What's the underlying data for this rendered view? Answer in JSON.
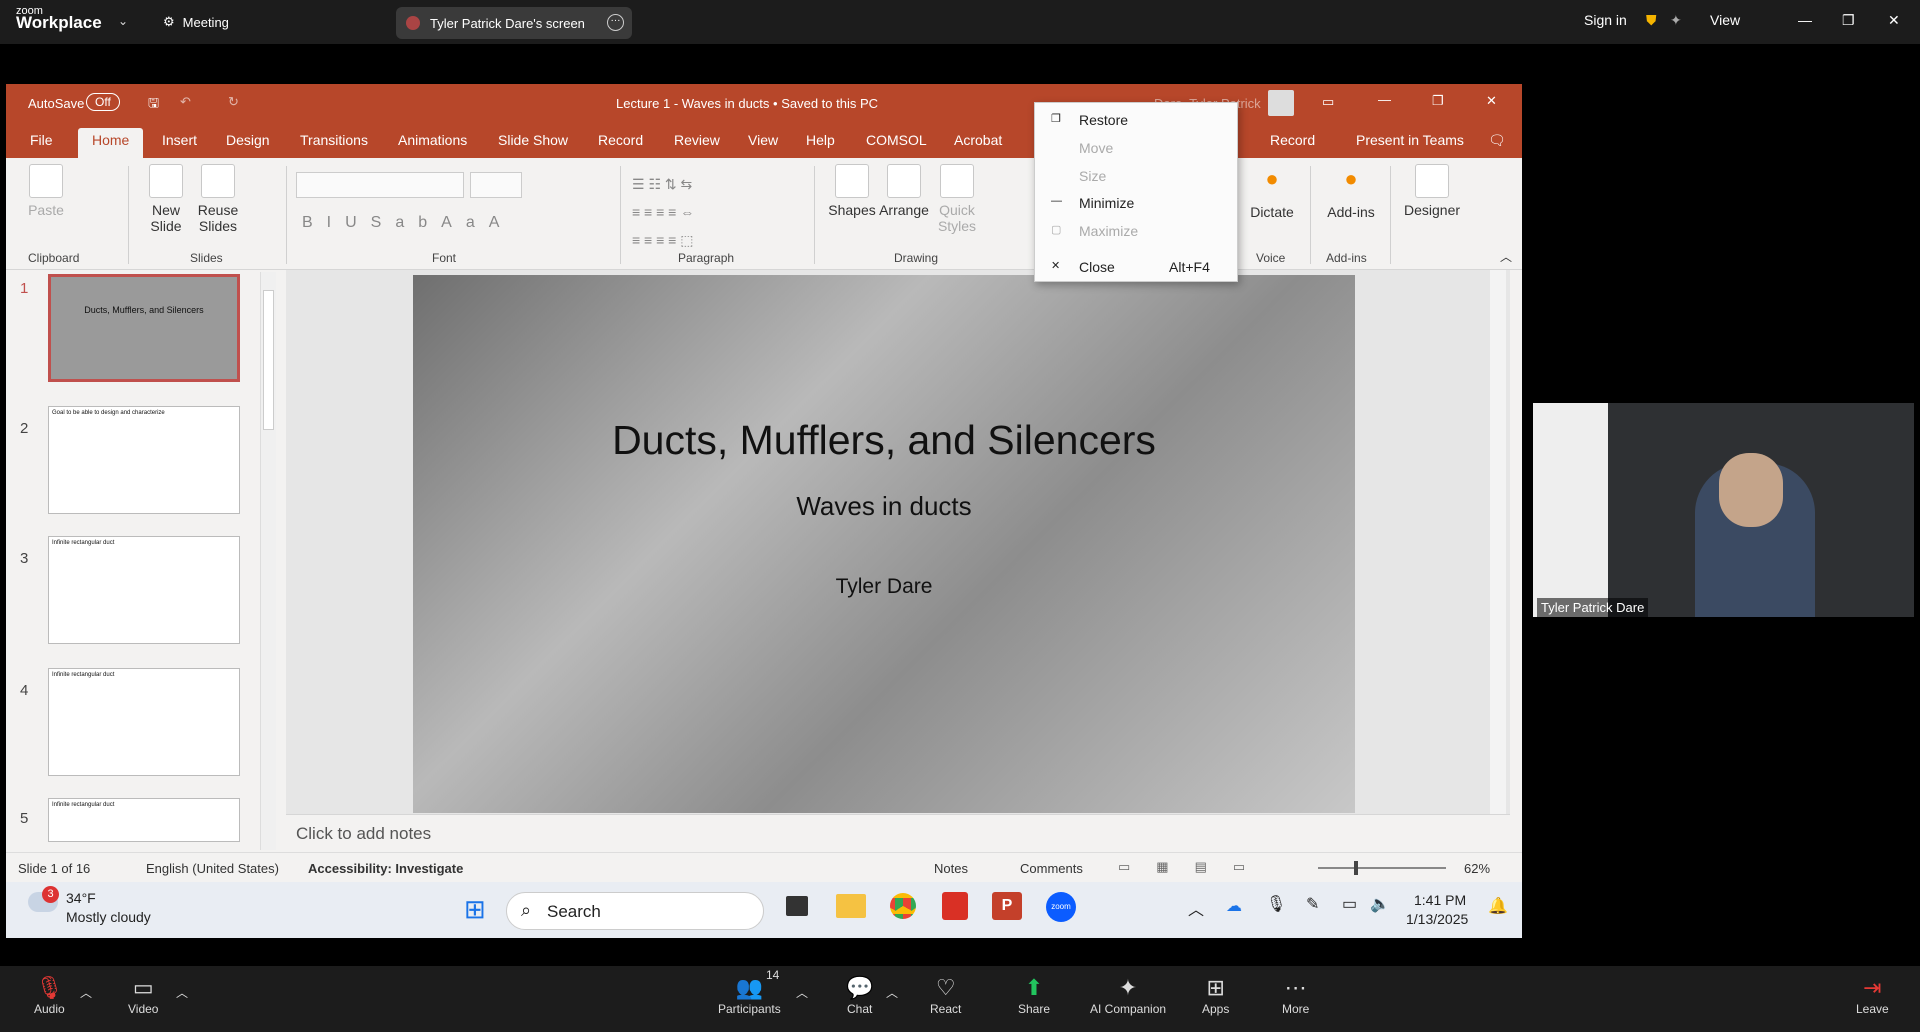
{
  "zoom_top": {
    "brand_top": "zoom",
    "brand_bottom": "Workplace",
    "meeting": "Meeting",
    "share_label": "Tyler Patrick Dare's screen",
    "sign_in": "Sign in",
    "view": "View"
  },
  "ppt": {
    "autosave": "AutoSave",
    "autosave_state": "Off",
    "title": "Lecture 1 - Waves in ducts • Saved to this PC",
    "user": "Dare, Tyler Patrick",
    "tabs": [
      "File",
      "Home",
      "Insert",
      "Design",
      "Transitions",
      "Animations",
      "Slide Show",
      "Record",
      "Review",
      "View",
      "Help",
      "COMSOL",
      "Acrobat"
    ],
    "record_btn": "Record",
    "present_teams": "Present in Teams",
    "ribbon": {
      "paste": "Paste",
      "new_slide": "New Slide",
      "reuse_slides": "Reuse Slides",
      "shapes": "Shapes",
      "arrange": "Arrange",
      "quick_styles": "Quick Styles",
      "dictate": "Dictate",
      "addins": "Add-ins",
      "designer": "Designer",
      "groups": {
        "clipboard": "Clipboard",
        "slides": "Slides",
        "font": "Font",
        "paragraph": "Paragraph",
        "drawing": "Drawing",
        "voice": "Voice",
        "addins": "Add-ins"
      }
    },
    "thumb_numbers": [
      "1",
      "2",
      "3",
      "4",
      "5"
    ],
    "thumb_titles": [
      "Ducts, Mufflers, and Silencers",
      "Goal to be able to design and characterize",
      "Infinite rectangular duct",
      "Infinite rectangular duct",
      "Infinite rectangular duct"
    ],
    "slide": {
      "title": "Ducts, Mufflers, and Silencers",
      "subtitle": "Waves in ducts",
      "author": "Tyler Dare"
    },
    "notes_placeholder": "Click to add notes",
    "status": {
      "slide": "Slide 1 of 16",
      "lang": "English (United States)",
      "access": "Accessibility: Investigate",
      "notes": "Notes",
      "comments": "Comments",
      "zoom": "62%"
    },
    "context_menu": {
      "restore": "Restore",
      "move": "Move",
      "size": "Size",
      "minimize": "Minimize",
      "maximize": "Maximize",
      "close": "Close",
      "close_key": "Alt+F4"
    }
  },
  "taskbar": {
    "badge": "3",
    "temp": "34°F",
    "weather": "Mostly cloudy",
    "search": "Search",
    "time": "1:41 PM",
    "date": "1/13/2025"
  },
  "video": {
    "name": "Tyler Patrick Dare"
  },
  "zoom_bar": {
    "audio": "Audio",
    "video": "Video",
    "participants": "Participants",
    "participants_count": "14",
    "chat": "Chat",
    "react": "React",
    "share": "Share",
    "ai": "AI Companion",
    "apps": "Apps",
    "more": "More",
    "leave": "Leave"
  },
  "colors": {
    "ppt_accent": "#b7472a",
    "zoom_share": "#22c55e"
  }
}
